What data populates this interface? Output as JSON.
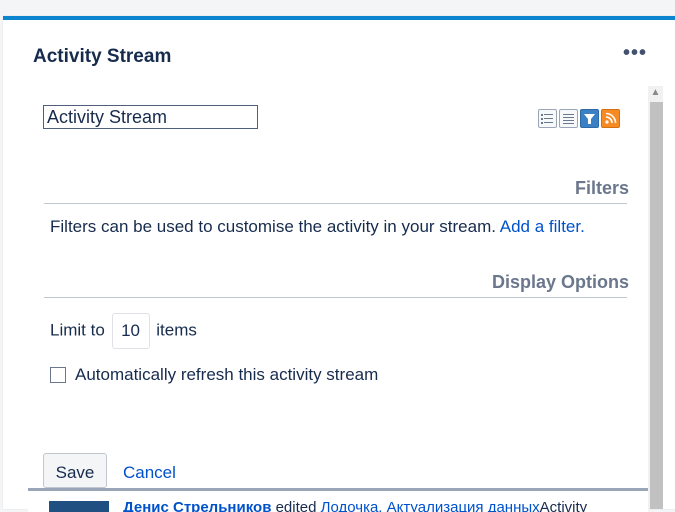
{
  "gadget": {
    "title": "Activity Stream"
  },
  "config": {
    "title_value": "Activity Stream",
    "filters_heading": "Filters",
    "filters_text": "Filters can be used to customise the activity in your stream.",
    "add_filter_link": "Add a filter.",
    "display_heading": "Display Options",
    "limit_prefix": "Limit to",
    "limit_value": "10",
    "limit_suffix": "items",
    "auto_refresh_label": "Automatically refresh this activity stream",
    "auto_refresh_checked": false,
    "save_label": "Save",
    "cancel_label": "Cancel",
    "view_icons": [
      "full-view-icon",
      "list-view-icon",
      "filter-view-icon",
      "rss-feed-icon"
    ]
  },
  "stream": {
    "user": "Денис Стрельников",
    "action": "edited",
    "link": "Лодочка. Актуализация данных",
    "tail": "Activity"
  },
  "colors": {
    "accent": "#0c85d0",
    "link": "#0052cc",
    "text": "#172b4d",
    "muted": "#6b778c"
  }
}
